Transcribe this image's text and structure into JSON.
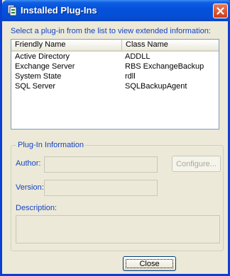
{
  "window": {
    "title": "Installed Plug-Ins",
    "icon": "plugin-app-icon",
    "close_icon": "close-icon"
  },
  "instruction": "Select a plug-in from the list to view extended information:",
  "list": {
    "columns": [
      "Friendly Name",
      "Class Name"
    ],
    "rows": [
      {
        "friendly": "Active Directory",
        "class": "ADDLL"
      },
      {
        "friendly": "Exchange Server",
        "class": "RBS ExchangeBackup"
      },
      {
        "friendly": "System State",
        "class": "rdll"
      },
      {
        "friendly": "SQL Server",
        "class": "SQLBackupAgent"
      }
    ]
  },
  "info": {
    "group_label": "Plug-In Information",
    "author_label": "Author:",
    "author_value": "",
    "version_label": "Version:",
    "version_value": "",
    "description_label": "Description:",
    "description_value": "",
    "configure_label": "Configure..."
  },
  "close_label": "Close",
  "colors": {
    "titlebar": "#0450d6",
    "label_blue": "#1543c2",
    "dialog_bg": "#ece9d8",
    "close_red": "#cc3d17"
  }
}
